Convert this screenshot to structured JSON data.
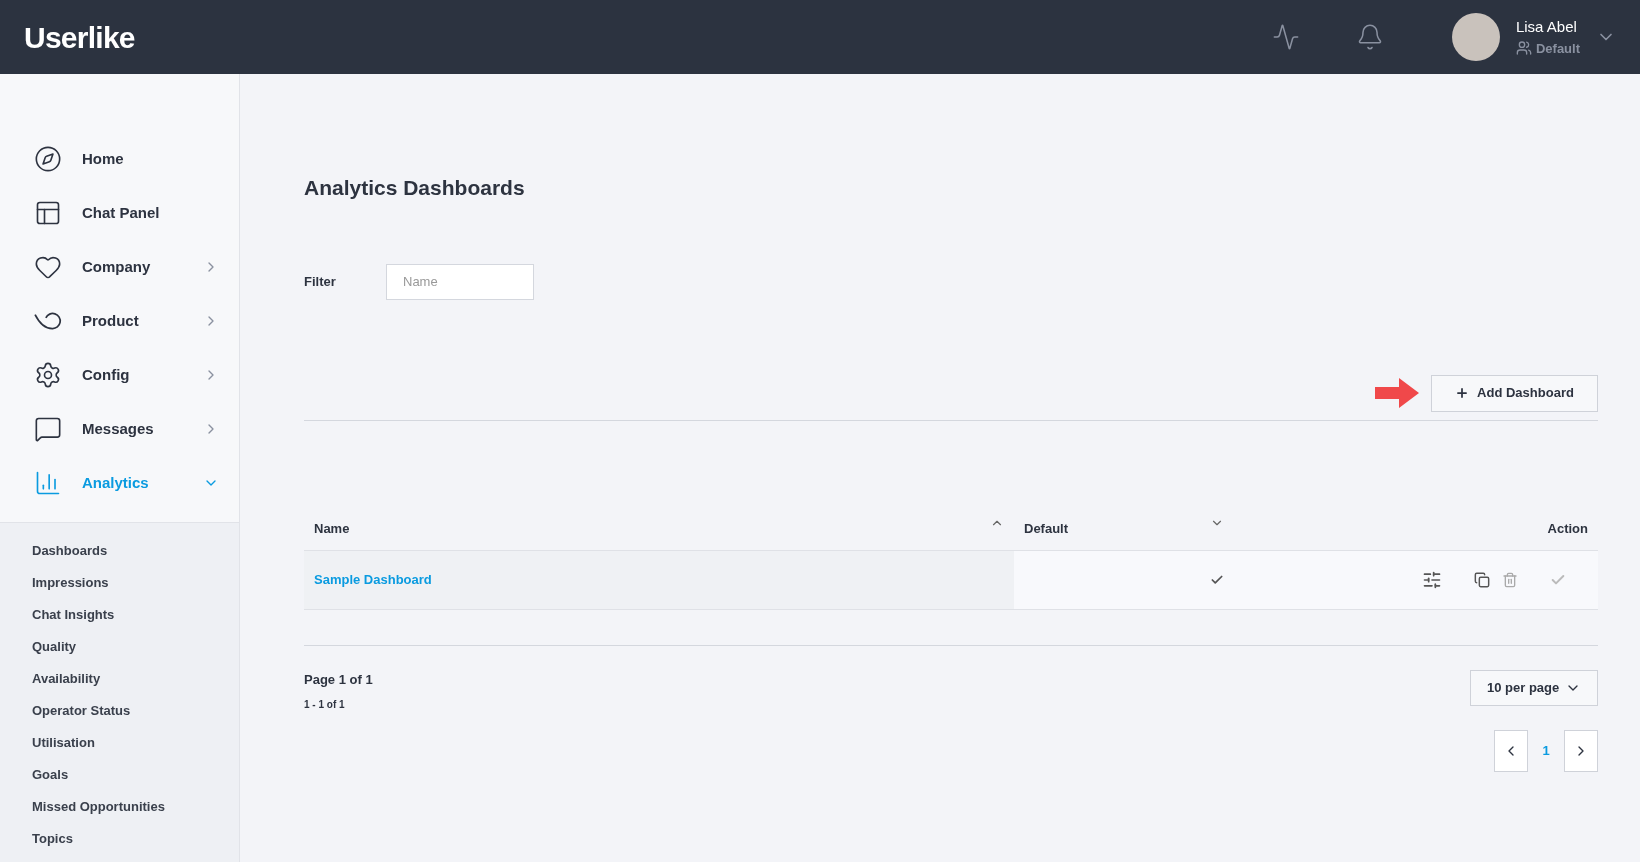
{
  "topbar": {
    "logo": "Userlike",
    "user": {
      "name": "Lisa Abel",
      "role": "Default"
    }
  },
  "sidebar": {
    "items": [
      {
        "label": "Home",
        "kind": "link",
        "selected": false
      },
      {
        "label": "Chat Panel",
        "kind": "link",
        "selected": false
      },
      {
        "label": "Company",
        "kind": "group",
        "expanded": false,
        "selected": false
      },
      {
        "label": "Product",
        "kind": "group",
        "expanded": false,
        "selected": false
      },
      {
        "label": "Config",
        "kind": "group",
        "expanded": false,
        "selected": false
      },
      {
        "label": "Messages",
        "kind": "group",
        "expanded": false,
        "selected": false
      },
      {
        "label": "Analytics",
        "kind": "group",
        "expanded": true,
        "selected": true
      }
    ],
    "subitems": [
      "Dashboards",
      "Impressions",
      "Chat Insights",
      "Quality",
      "Availability",
      "Operator Status",
      "Utilisation",
      "Goals",
      "Missed Opportunities",
      "Topics"
    ]
  },
  "page": {
    "title": "Analytics Dashboards",
    "filter": {
      "label": "Filter",
      "placeholder": "Name"
    },
    "add_button": "Add Dashboard"
  },
  "table": {
    "columns": [
      {
        "label": "Name",
        "kind": "ascending"
      },
      {
        "label": "Default",
        "kind": "descending"
      },
      {
        "label": "Action",
        "kind": "plain"
      }
    ],
    "rows": [
      {
        "name": "Sample Dashboard",
        "default": true
      }
    ]
  },
  "pagination": {
    "page_label": "Page 1 of 1",
    "range": "1 - 1 of 1",
    "per_page": "10 per page",
    "pages": [
      {
        "label": "1",
        "selected": true
      }
    ]
  }
}
